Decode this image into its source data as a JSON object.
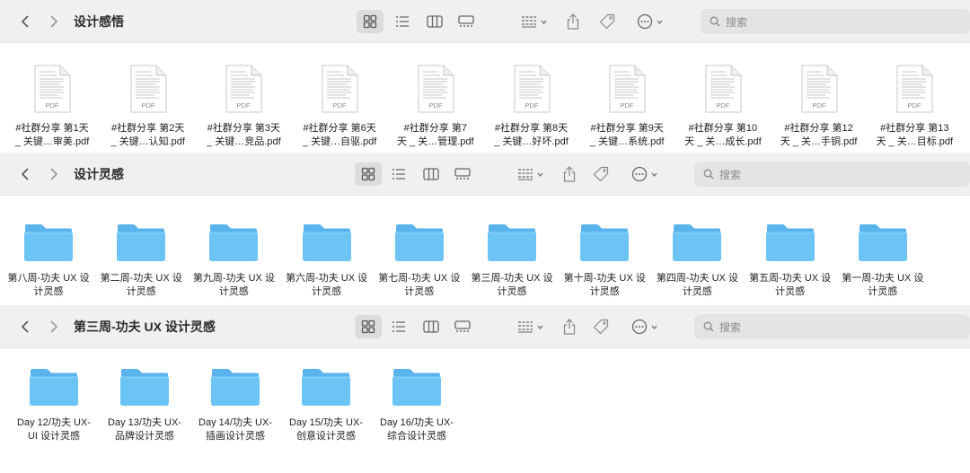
{
  "common": {
    "search_placeholder": "搜索"
  },
  "windows": [
    {
      "title": "设计感悟",
      "items": [
        {
          "type": "pdf",
          "line1": "#社群分享 第1天",
          "line2": "_ 关键…审美.pdf"
        },
        {
          "type": "pdf",
          "line1": "#社群分享 第2天",
          "line2": "_ 关键…认知.pdf"
        },
        {
          "type": "pdf",
          "line1": "#社群分享 第3天",
          "line2": "_ 关键…竞品.pdf"
        },
        {
          "type": "pdf",
          "line1": "#社群分享 第6天",
          "line2": "_ 关键…自驱.pdf"
        },
        {
          "type": "pdf",
          "line1": "#社群分享 第7",
          "line2": "天 _ 关…管理.pdf"
        },
        {
          "type": "pdf",
          "line1": "#社群分享 第8天",
          "line2": "_ 关键…好坏.pdf"
        },
        {
          "type": "pdf",
          "line1": "#社群分享 第9天",
          "line2": "_ 关键…系统.pdf"
        },
        {
          "type": "pdf",
          "line1": "#社群分享 第10",
          "line2": "天 _ 关…成长.pdf"
        },
        {
          "type": "pdf",
          "line1": "#社群分享 第12",
          "line2": "天 _ 关…手铜.pdf"
        },
        {
          "type": "pdf",
          "line1": "#社群分享 第13",
          "line2": "天 _ 关…目标.pdf"
        }
      ],
      "pdf_badge": "PDF"
    },
    {
      "title": "设计灵感",
      "items": [
        {
          "type": "folder",
          "line1": "第八周-功夫 UX 设",
          "line2": "计灵感"
        },
        {
          "type": "folder",
          "line1": "第二周-功夫 UX 设",
          "line2": "计灵感"
        },
        {
          "type": "folder",
          "line1": "第九周-功夫 UX 设",
          "line2": "计灵感"
        },
        {
          "type": "folder",
          "line1": "第六周-功夫 UX 设",
          "line2": "计灵感"
        },
        {
          "type": "folder",
          "line1": "第七周-功夫 UX 设",
          "line2": "计灵感"
        },
        {
          "type": "folder",
          "line1": "第三周-功夫 UX 设",
          "line2": "计灵感"
        },
        {
          "type": "folder",
          "line1": "第十周-功夫 UX 设",
          "line2": "计灵感"
        },
        {
          "type": "folder",
          "line1": "第四周-功夫 UX 设",
          "line2": "计灵感"
        },
        {
          "type": "folder",
          "line1": "第五周-功夫 UX 设",
          "line2": "计灵感"
        },
        {
          "type": "folder",
          "line1": "第一周-功夫 UX 设",
          "line2": "计灵感"
        }
      ]
    },
    {
      "title": "第三周-功夫 UX 设计灵感",
      "items": [
        {
          "type": "folder",
          "line1": "Day 12/功夫 UX-",
          "line2": "UI 设计灵感"
        },
        {
          "type": "folder",
          "line1": "Day 13/功夫 UX-",
          "line2": "品牌设计灵感"
        },
        {
          "type": "folder",
          "line1": "Day 14/功夫 UX-",
          "line2": "插画设计灵感"
        },
        {
          "type": "folder",
          "line1": "Day 15/功夫 UX-",
          "line2": "创意设计灵感"
        },
        {
          "type": "folder",
          "line1": "Day 16/功夫 UX-",
          "line2": "综合设计灵感"
        }
      ]
    }
  ],
  "colors": {
    "folder_top": "#5ab3ec",
    "folder_body": "#6cc4f4",
    "toolbar_bg": "#f0f0f0"
  },
  "icons": [
    "back-chevron-icon",
    "forward-chevron-icon",
    "icon-view-icon",
    "list-view-icon",
    "column-view-icon",
    "gallery-view-icon",
    "group-icon",
    "share-icon",
    "tag-icon",
    "more-icon",
    "search-icon",
    "pdf-file-icon",
    "folder-icon"
  ]
}
